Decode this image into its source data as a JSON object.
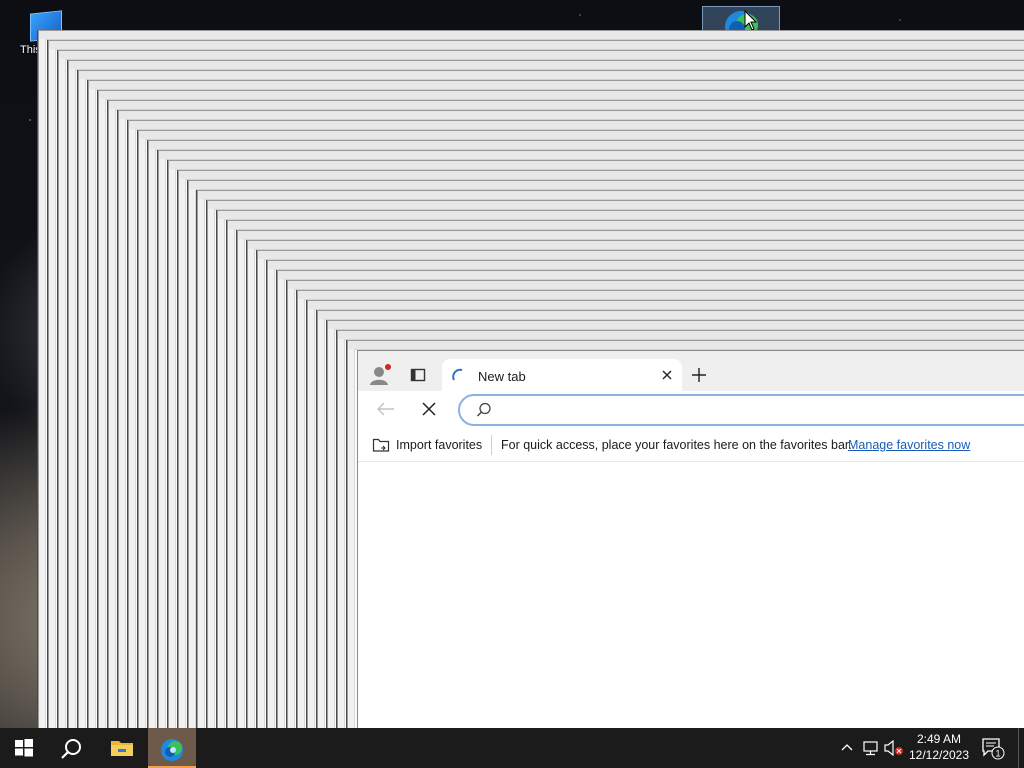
{
  "desktop": {
    "icon_label": "This"
  },
  "browser": {
    "tab_title": "New tab",
    "address_value": "",
    "address_placeholder": "",
    "favorites_bar": {
      "import_label": "Import favorites",
      "message": "For quick access, place your favorites here on the favorites bar.",
      "manage_link": "Manage favorites now"
    }
  },
  "taskbar": {
    "time": "2:49 AM",
    "date": "12/12/2023",
    "notification_count": "1"
  },
  "colors": {
    "taskbar": "#1b1b1b",
    "accent_active": "#f3a24a",
    "link": "#1a5bb8",
    "address_focus": "#8ab3e0"
  },
  "icons": [
    "windows-start-icon",
    "search-icon",
    "file-explorer-icon",
    "edge-icon",
    "chevron-up-icon",
    "network-icon",
    "volume-muted-icon",
    "notification-icon",
    "profile-icon",
    "tab-actions-icon",
    "loading-icon",
    "close-icon",
    "plus-icon",
    "back-arrow-icon",
    "stop-icon",
    "import-icon"
  ]
}
